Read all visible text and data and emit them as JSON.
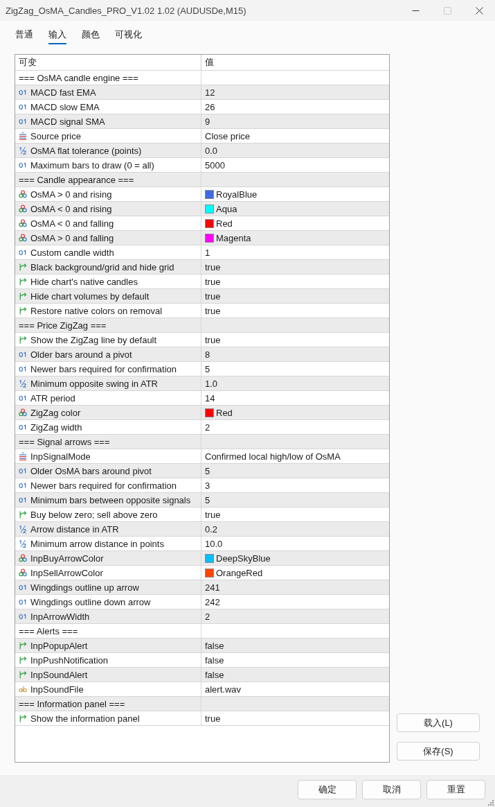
{
  "window": {
    "title": "ZigZag_OsMA_Candles_PRO_V1.02 1.02 (AUDUSDe,M15)",
    "maximize_disabled": true
  },
  "tabs": [
    {
      "label": "普通",
      "selected": false
    },
    {
      "label": "输入",
      "selected": true
    },
    {
      "label": "颜色",
      "selected": false
    },
    {
      "label": "可视化",
      "selected": false
    }
  ],
  "table": {
    "columns": [
      "可变",
      "值"
    ],
    "rows": [
      {
        "kind": "group",
        "name": "=== OsMA candle engine ==="
      },
      {
        "kind": "int",
        "name": "MACD fast EMA",
        "value": "12"
      },
      {
        "kind": "int",
        "name": "MACD slow EMA",
        "value": "26"
      },
      {
        "kind": "int",
        "name": "MACD signal SMA",
        "value": "9"
      },
      {
        "kind": "enum",
        "name": "Source price",
        "value": "Close price"
      },
      {
        "kind": "double",
        "name": "OsMA flat tolerance (points)",
        "value": "0.0"
      },
      {
        "kind": "int",
        "name": "Maximum bars to draw (0 = all)",
        "value": "5000"
      },
      {
        "kind": "group",
        "name": "=== Candle appearance ==="
      },
      {
        "kind": "color",
        "name": "OsMA > 0 and rising",
        "value": "RoyalBlue",
        "color": "#4169e1"
      },
      {
        "kind": "color",
        "name": "OsMA < 0 and rising",
        "value": "Aqua",
        "color": "#00ffff"
      },
      {
        "kind": "color",
        "name": "OsMA < 0 and falling",
        "value": "Red",
        "color": "#ff0000"
      },
      {
        "kind": "color",
        "name": "OsMA > 0 and falling",
        "value": "Magenta",
        "color": "#ff00ff"
      },
      {
        "kind": "int",
        "name": "Custom candle width",
        "value": "1"
      },
      {
        "kind": "bool",
        "name": "Black background/grid and hide grid",
        "value": "true"
      },
      {
        "kind": "bool",
        "name": "Hide chart's native candles",
        "value": "true"
      },
      {
        "kind": "bool",
        "name": "Hide chart volumes by default",
        "value": "true"
      },
      {
        "kind": "bool",
        "name": "Restore native colors on removal",
        "value": "true"
      },
      {
        "kind": "group",
        "name": "=== Price ZigZag ==="
      },
      {
        "kind": "bool",
        "name": "Show the ZigZag line by default",
        "value": "true"
      },
      {
        "kind": "int",
        "name": "Older bars around a pivot",
        "value": "8"
      },
      {
        "kind": "int",
        "name": "Newer bars required for confirmation",
        "value": "5"
      },
      {
        "kind": "double",
        "name": "Minimum opposite swing in ATR",
        "value": "1.0"
      },
      {
        "kind": "int",
        "name": "ATR period",
        "value": "14"
      },
      {
        "kind": "color",
        "name": "ZigZag color",
        "value": "Red",
        "color": "#ff0000"
      },
      {
        "kind": "int",
        "name": "ZigZag width",
        "value": "2"
      },
      {
        "kind": "group",
        "name": "=== Signal arrows ==="
      },
      {
        "kind": "enum",
        "name": "InpSignalMode",
        "value": "Confirmed local high/low of OsMA"
      },
      {
        "kind": "int",
        "name": "Older OsMA bars around pivot",
        "value": "5"
      },
      {
        "kind": "int",
        "name": "Newer bars required for confirmation",
        "value": "3"
      },
      {
        "kind": "int",
        "name": "Minimum bars between opposite signals",
        "value": "5"
      },
      {
        "kind": "bool",
        "name": "Buy below zero; sell above zero",
        "value": "true"
      },
      {
        "kind": "double",
        "name": "Arrow distance in ATR",
        "value": "0.2"
      },
      {
        "kind": "double",
        "name": "Minimum arrow distance in points",
        "value": "10.0"
      },
      {
        "kind": "color",
        "name": "InpBuyArrowColor",
        "value": "DeepSkyBlue",
        "color": "#00bfff"
      },
      {
        "kind": "color",
        "name": "InpSellArrowColor",
        "value": "OrangeRed",
        "color": "#ff4500"
      },
      {
        "kind": "int",
        "name": "Wingdings outline up arrow",
        "value": "241"
      },
      {
        "kind": "int",
        "name": "Wingdings outline down arrow",
        "value": "242"
      },
      {
        "kind": "int",
        "name": "InpArrowWidth",
        "value": "2"
      },
      {
        "kind": "group",
        "name": "=== Alerts ==="
      },
      {
        "kind": "bool",
        "name": "InpPopupAlert",
        "value": "false"
      },
      {
        "kind": "bool",
        "name": "InpPushNotification",
        "value": "false"
      },
      {
        "kind": "bool",
        "name": "InpSoundAlert",
        "value": "false"
      },
      {
        "kind": "string",
        "name": "InpSoundFile",
        "value": "alert.wav"
      },
      {
        "kind": "group",
        "name": "=== Information panel ==="
      },
      {
        "kind": "bool",
        "name": "Show the information panel",
        "value": "true"
      }
    ]
  },
  "side_buttons": [
    "载入(L)",
    "保存(S)"
  ],
  "buttons": [
    "确定",
    "取消",
    "重置"
  ]
}
